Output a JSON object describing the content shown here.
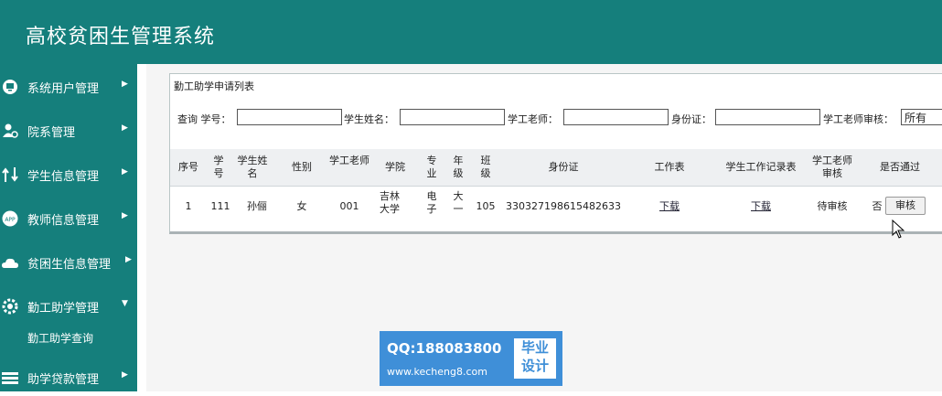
{
  "header": {
    "title": "高校贫困生管理系统"
  },
  "sidebar": {
    "items": [
      {
        "label": "系统用户管理",
        "icon": "monitor-icon"
      },
      {
        "label": "院系管理",
        "icon": "user-gear-icon"
      },
      {
        "label": "学生信息管理",
        "icon": "arrows-icon"
      },
      {
        "label": "教师信息管理",
        "icon": "app-icon"
      },
      {
        "label": "贫困生信息管理",
        "icon": "cloud-icon"
      },
      {
        "label": "勤工助学管理",
        "icon": "gear-icon"
      },
      {
        "label": "助学贷款管理",
        "icon": "stack-icon"
      }
    ],
    "sub_item": "勤工助学查询"
  },
  "panel": {
    "title": "勤工助学申请列表",
    "search": {
      "label_query": "查询 学号：",
      "label_name": "学生姓名：",
      "label_teacher": "学工老师：",
      "label_id": "身份证：",
      "label_review": "学工老师审核：",
      "review_value": "所有"
    },
    "table": {
      "headers": [
        "序号",
        "学号",
        "学生姓名",
        "性别",
        "学工老师",
        "学院",
        "专业",
        "年级",
        "班级",
        "身份证",
        "工作表",
        "学生工作记录表",
        "学工老师审核",
        "是否通过"
      ],
      "row": {
        "no": "1",
        "student_id": "111",
        "name": "孙俪",
        "gender": "女",
        "teacher": "001",
        "college": "吉林大学",
        "major": "电子",
        "grade": "大一",
        "class": "105",
        "id_card": "330327198615482633",
        "worksheet": "下载",
        "record": "下载",
        "review": "待审核",
        "passed": "否",
        "action": "审核"
      }
    }
  },
  "watermark": {
    "qq": "QQ:188083800",
    "url": "www.kecheng8.com",
    "tag1": "毕业",
    "tag2": "设计"
  }
}
